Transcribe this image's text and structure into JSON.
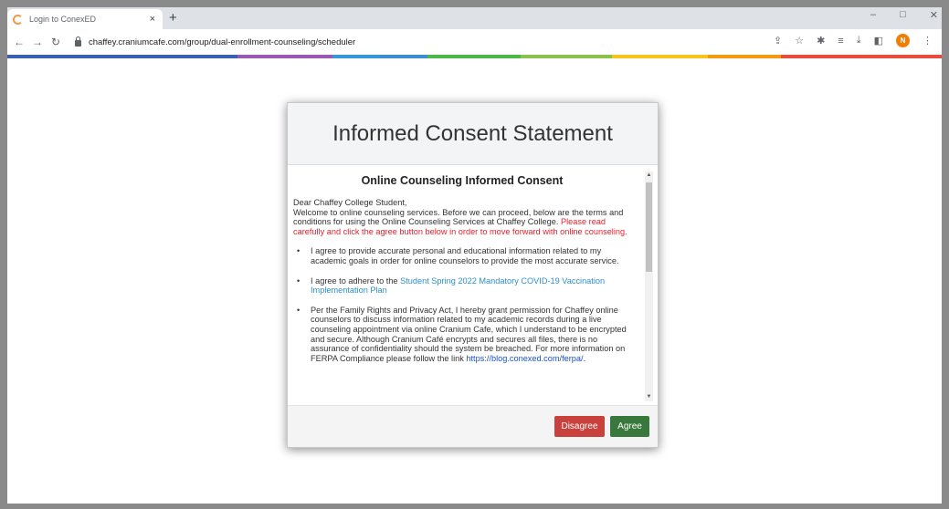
{
  "browser": {
    "tab_title": "Login to ConexED",
    "tab_close": "×",
    "new_tab": "+",
    "url": "chaffey.craniumcafe.com/group/dual-enrollment-counseling/scheduler",
    "avatar_initial": "N",
    "win_minimize": "–",
    "win_maximize": "□",
    "win_close": "✕"
  },
  "color_bar": [
    "#3b5fb5",
    "#9b59b6",
    "#3498db",
    "#3b8fd1",
    "#4cb848",
    "#8bc34a",
    "#f7c31d",
    "#f39c12",
    "#e74c3c"
  ],
  "modal": {
    "title": "Informed Consent Statement",
    "section_title": "Online Counseling Informed Consent",
    "greeting": "Dear Chaffey College Student,",
    "intro": "Welcome to online counseling services. Before we can proceed, below are the terms and conditions for using the Online Counseling Services at Chaffey College. ",
    "intro_red": "Please read carefully and click the agree button below in order to move forward with online counseling.",
    "bullet1": " I agree to provide accurate personal and educational information related to my academic goals in order for online counselors to provide the most accurate service.",
    "bullet2_text": " I agree to adhere to the ",
    "bullet2_link": "Student Spring 2022 Mandatory COVID-19 Vaccination Implementation Plan",
    "bullet3_text": " Per the Family Rights and Privacy Act, I hereby grant permission for Chaffey online counselors to discuss information related to my academic records during a live counseling appointment via online Cranium Cafe, which I understand to be encrypted and secure. Although Cranium Café encrypts and secures all files, there is no assurance of confidentiality should the system be breached. For more information on FERPA Compliance please follow the link ",
    "bullet3_link": "https://blog.conexed.com/ferpa/",
    "bullet3_end": ".",
    "bullet_mark": "•",
    "disagree_label": "Disagree",
    "agree_label": "Agree"
  }
}
